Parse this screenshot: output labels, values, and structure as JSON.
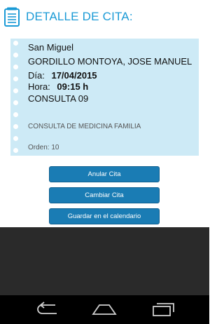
{
  "header": {
    "title": "DETALLE DE CITA:",
    "icon": "notepad-icon"
  },
  "appointment": {
    "place": "San Miguel",
    "patient": "GORDILLO MONTOYA, JOSE MANUEL",
    "date_label": "Día:",
    "date_value": "17/04/2015",
    "time_label": "Hora:",
    "time_value": "09:15 h",
    "room": "CONSULTA 09",
    "specialty": "CONSULTA DE MEDICINA FAMILIA",
    "order": "Orden: 10"
  },
  "actions": {
    "cancel": "Anular Cita",
    "change": "Cambiar Cita",
    "save_calendar": "Guardar en el calendario"
  },
  "navbar": {
    "back_icon": "back-icon",
    "home_icon": "home-icon",
    "recents_icon": "recent-apps-icon"
  },
  "colors": {
    "accent": "#1a9ad6",
    "button": "#1a7cb4",
    "card": "#cdeaf6"
  }
}
